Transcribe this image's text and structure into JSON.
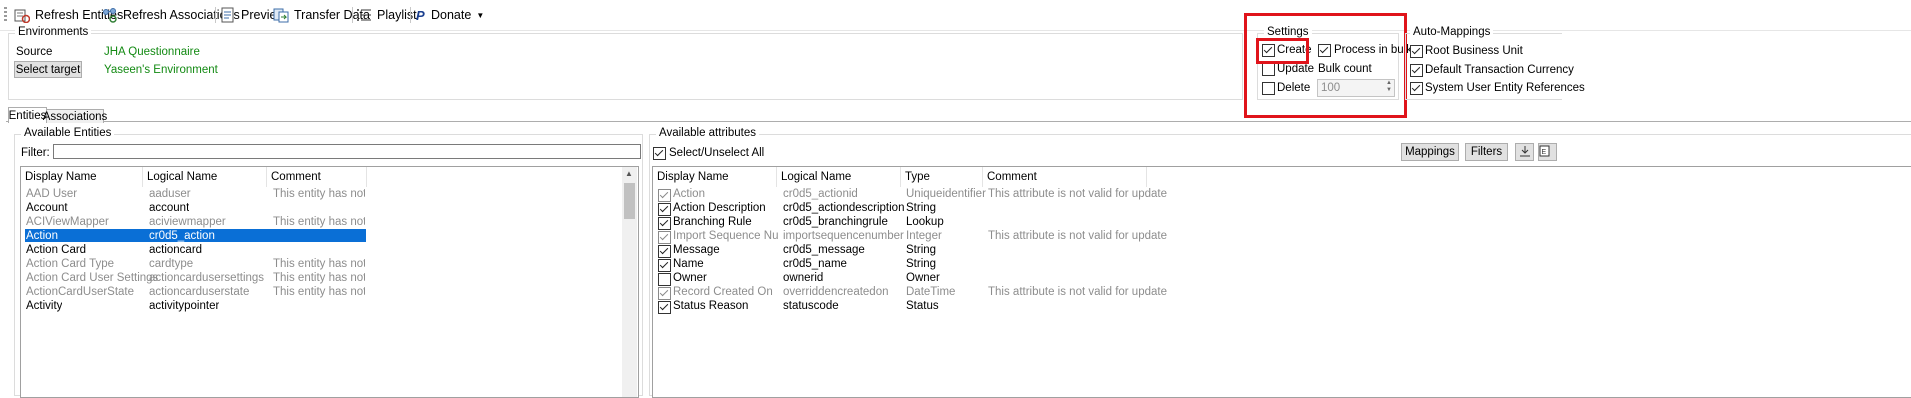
{
  "toolbar": {
    "refresh_entities": "Refresh Entities",
    "refresh_associations": "Refresh Associations",
    "preview": "Preview",
    "transfer_data": "Transfer Data",
    "playlist": "Playlist",
    "donate": "Donate"
  },
  "environments": {
    "title": "Environments",
    "source_label": "Source",
    "source_value": "JHA Questionnaire",
    "select_target": "Select target",
    "target_value": "Yaseen's Environment"
  },
  "settings": {
    "title": "Settings",
    "create": "Create",
    "create_checked": true,
    "process_in_bulk": "Process in bulk",
    "process_in_bulk_checked": true,
    "update": "Update",
    "update_checked": false,
    "bulk_count_label": "Bulk count",
    "delete": "Delete",
    "delete_checked": false,
    "bulk_count_value": "100"
  },
  "auto_mappings": {
    "title": "Auto-Mappings",
    "items": [
      {
        "label": "Root Business Unit",
        "checked": true
      },
      {
        "label": "Default Transaction Currency",
        "checked": true
      },
      {
        "label": "System User Entity References",
        "checked": true
      }
    ]
  },
  "tabs": [
    "Entities",
    "Associations"
  ],
  "entities": {
    "title": "Available Entities",
    "filter_label": "Filter:",
    "filter_value": "",
    "columns": [
      "Display Name",
      "Logical Name",
      "Comment"
    ],
    "rows": [
      {
        "display": "AAD User",
        "logical": "aaduser",
        "comment": "This entity has not b...",
        "dim": true
      },
      {
        "display": "Account",
        "logical": "account",
        "comment": "",
        "dim": false
      },
      {
        "display": "ACIViewMapper",
        "logical": "aciviewmapper",
        "comment": "This entity has not b...",
        "dim": true
      },
      {
        "display": "Action",
        "logical": "cr0d5_action",
        "comment": "",
        "dim": false,
        "selected": true
      },
      {
        "display": "Action Card",
        "logical": "actioncard",
        "comment": "",
        "dim": false
      },
      {
        "display": "Action Card Type",
        "logical": "cardtype",
        "comment": "This entity has not b...",
        "dim": true
      },
      {
        "display": "Action Card User Settings",
        "logical": "actioncardusersettings",
        "comment": "This entity has not b...",
        "dim": true
      },
      {
        "display": "ActionCardUserState",
        "logical": "actioncarduserstate",
        "comment": "This entity has not b...",
        "dim": true
      },
      {
        "display": "Activity",
        "logical": "activitypointer",
        "comment": "",
        "dim": false
      }
    ]
  },
  "attributes": {
    "title": "Available attributes",
    "select_all": "Select/Unselect All",
    "select_all_checked": true,
    "mappings_button": "Mappings",
    "filters_button": "Filters",
    "columns": [
      "Display Name",
      "Logical Name",
      "Type",
      "Comment"
    ],
    "rows": [
      {
        "checked": true,
        "display": "Action",
        "logical": "cr0d5_actionid",
        "type": "Uniqueidentifier",
        "comment": "This attribute is not valid for update",
        "dim": true
      },
      {
        "checked": true,
        "display": "Action Description",
        "logical": "cr0d5_actiondescription",
        "type": "String",
        "comment": "",
        "dim": false
      },
      {
        "checked": true,
        "display": "Branching Rule",
        "logical": "cr0d5_branchingrule",
        "type": "Lookup",
        "comment": "",
        "dim": false
      },
      {
        "checked": true,
        "display": "Import Sequence Num...",
        "logical": "importsequencenumber",
        "type": "Integer",
        "comment": "This attribute is not valid for update",
        "dim": true
      },
      {
        "checked": true,
        "display": "Message",
        "logical": "cr0d5_message",
        "type": "String",
        "comment": "",
        "dim": false
      },
      {
        "checked": true,
        "display": "Name",
        "logical": "cr0d5_name",
        "type": "String",
        "comment": "",
        "dim": false
      },
      {
        "checked": false,
        "display": "Owner",
        "logical": "ownerid",
        "type": "Owner",
        "comment": "",
        "dim": false
      },
      {
        "checked": true,
        "display": "Record Created On",
        "logical": "overriddencreatedon",
        "type": "DateTime",
        "comment": "This attribute is not valid for update",
        "dim": true
      },
      {
        "checked": true,
        "display": "Status Reason",
        "logical": "statuscode",
        "type": "Status",
        "comment": "",
        "dim": false
      }
    ]
  },
  "colors": {
    "highlight": "#e0141b",
    "selection": "#0a6fd6",
    "env_value": "#138a13"
  }
}
